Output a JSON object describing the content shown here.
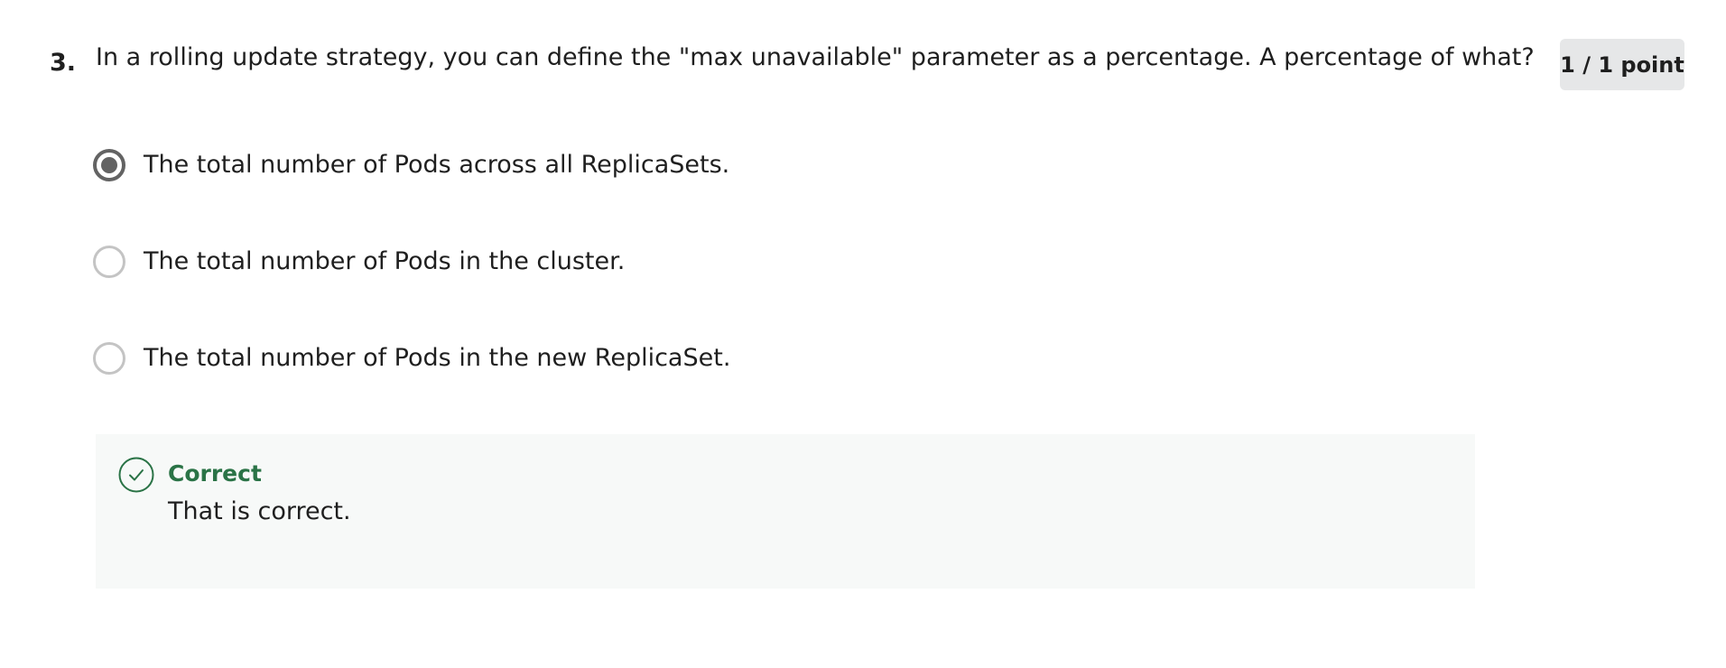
{
  "question": {
    "number": "3.",
    "text": "In a rolling update strategy, you can define the \"max unavailable\" parameter as a percentage. A percentage of what?",
    "score": "1 / 1 point"
  },
  "options": [
    {
      "label": "The total number of Pods across all ReplicaSets.",
      "selected": true
    },
    {
      "label": "The total number of Pods in the cluster.",
      "selected": false
    },
    {
      "label": "The total number of Pods in the new ReplicaSet.",
      "selected": false
    }
  ],
  "feedback": {
    "icon": "check-circle-icon",
    "status": "Correct",
    "message": "That is correct.",
    "status_color": "#2a7346"
  }
}
